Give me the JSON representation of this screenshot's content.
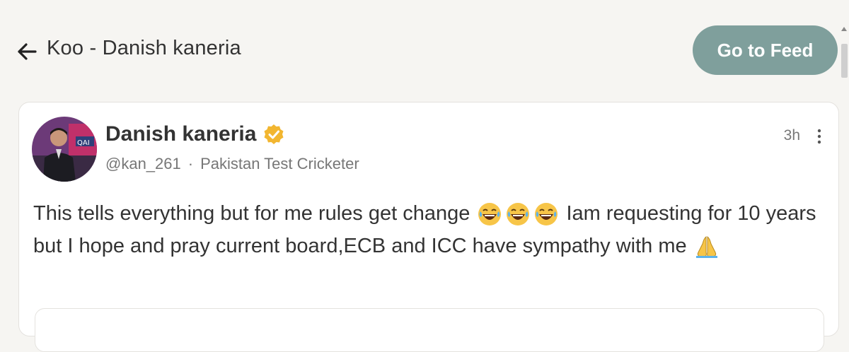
{
  "header": {
    "title": "Koo - Danish kaneria",
    "go_to_feed_label": "Go to Feed"
  },
  "post": {
    "author_name": "Danish kaneria",
    "handle": "@kan_261",
    "separator": "·",
    "bio": "Pakistan Test Cricketer",
    "time": "3h",
    "text_part1": "This tells everything but for me rules get change ",
    "text_part2": " Iam requesting for 10 years but I hope and pray current board,ECB and ICC have sympathy with me ",
    "emojis": [
      "laughing-tears-icon",
      "laughing-tears-icon",
      "laughing-tears-icon",
      "folded-hands-icon"
    ]
  },
  "colors": {
    "accent_button": "#7f9f9c",
    "verified_badge": "#f2b630",
    "background": "#f6f5f2"
  }
}
